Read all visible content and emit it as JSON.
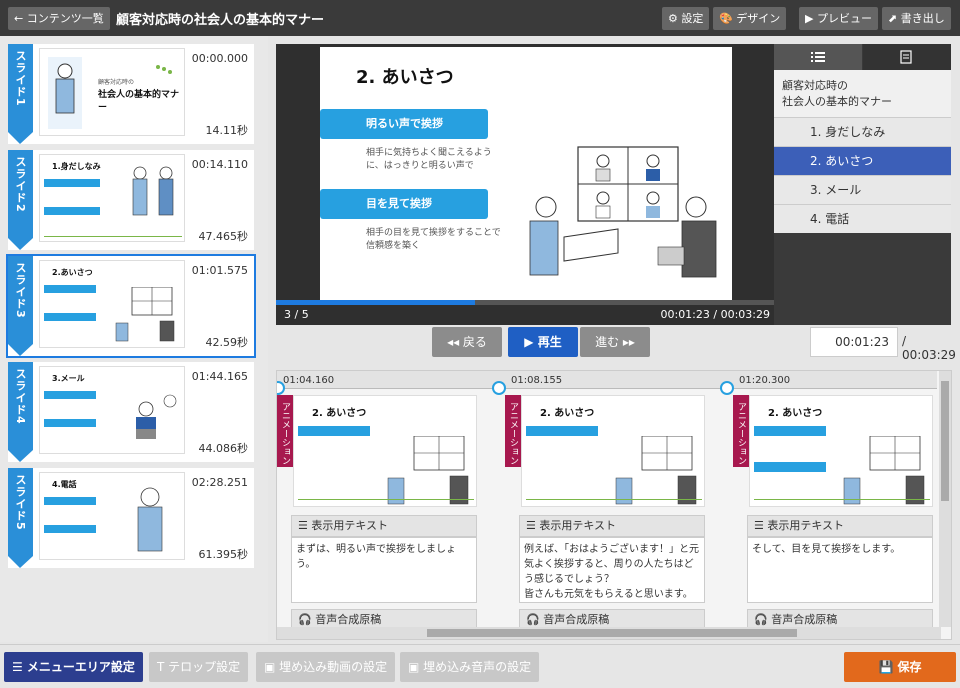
{
  "header": {
    "back_label": "← コンテンツ一覧",
    "title": "顧客対応時の社会人の基本的マナー",
    "settings_label": "⚙ 設定",
    "design_label": "🎨 デザイン",
    "preview_label": "▶ プレビュー",
    "export_label": "⬈ 書き出し"
  },
  "slides": [
    {
      "tab": "スライド1",
      "start": "00:00.000",
      "duration": "14.11秒",
      "thumb_title": "社会人の基本的マナー",
      "thumb_sub": "顧客対応時の"
    },
    {
      "tab": "スライド2",
      "start": "00:14.110",
      "duration": "47.465秒",
      "thumb_title": "1.身だしなみ"
    },
    {
      "tab": "スライド3",
      "start": "01:01.575",
      "duration": "42.59秒",
      "thumb_title": "2.あいさつ"
    },
    {
      "tab": "スライド4",
      "start": "01:44.165",
      "duration": "44.086秒",
      "thumb_title": "3.メール"
    },
    {
      "tab": "スライド5",
      "start": "02:28.251",
      "duration": "61.395秒",
      "thumb_title": "4.電話"
    }
  ],
  "player": {
    "slide_title": "2. あいさつ",
    "point1_label": "明るい声で挨拶",
    "point1_text": "相手に気持ちよく聞こえるように、はっきりと明るい声で",
    "point2_label": "目を見て挨拶",
    "point2_text": "相手の目を見て挨拶をすることで信頼感を築く",
    "page_counter": "3 / 5",
    "time_readout": "00:01:23 / 00:03:29",
    "progress": 0.4
  },
  "toc": {
    "title": "顧客対応時の\n社会人の基本的マナー",
    "items": [
      "1. 身だしなみ",
      "2. あいさつ",
      "3. メール",
      "4. 電話"
    ]
  },
  "controls": {
    "back_label": "◂◂ 戻る",
    "play_label": "▶ 再生",
    "forward_label": "進む ▸▸",
    "time_value": "00:01:23",
    "time_total": "/ 00:03:29"
  },
  "timeline": {
    "markers": [
      "01:04.160",
      "01:08.155",
      "01:20.300"
    ],
    "cards": [
      {
        "tag": "アニメーション",
        "slide_title": "2. あいさつ",
        "text_header": "☰ 表示用テキスト",
        "text": "まずは、明るい声で挨拶をしましょう。",
        "voice_header": "🎧 音声合成原稿"
      },
      {
        "tag": "アニメーション",
        "slide_title": "2. あいさつ",
        "text_header": "☰ 表示用テキスト",
        "text": "例えば、「おはようございます！」と元気よく挨拶すると、周りの人たちはどう感じるでしょう？\n皆さんも元気をもらえると思います。",
        "voice_header": "🎧 音声合成原稿"
      },
      {
        "tag": "アニメーション",
        "slide_title": "2. あいさつ",
        "text_header": "☰ 表示用テキスト",
        "text": "そして、目を見て挨拶をします。",
        "voice_header": "🎧 音声合成原稿"
      }
    ]
  },
  "footer": {
    "menu_label": "☰ メニューエリア設定",
    "telop_label": "T テロップ設定",
    "embed_video_label": "▣ 埋め込み動画の設定",
    "embed_audio_label": "▣ 埋め込み音声の設定",
    "save_label": "💾 保存"
  },
  "colors": {
    "accent_blue": "#1e7be0",
    "slide_tab_blue": "#2a8fd8",
    "toc_active": "#3c5fb8",
    "animation_tag": "#a7184e",
    "save_orange": "#e2691c",
    "menu_button": "#2c3e8f"
  }
}
